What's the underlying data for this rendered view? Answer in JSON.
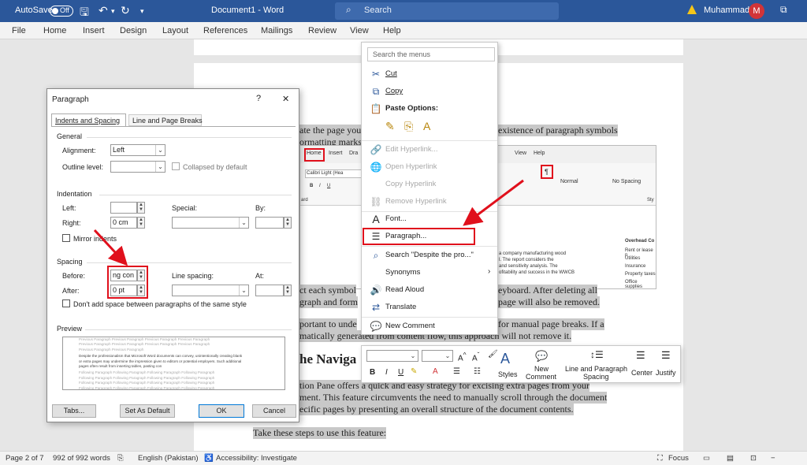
{
  "titlebar": {
    "autosave_label": "AutoSave",
    "autosave_state": "Off",
    "doc_title": "Document1 - Word",
    "search_placeholder": "Search",
    "user_name": "Muhammad",
    "user_initial": "M"
  },
  "menubar": {
    "items": [
      "File",
      "Home",
      "Insert",
      "Design",
      "Layout",
      "References",
      "Mailings",
      "Review",
      "View",
      "Help"
    ]
  },
  "document": {
    "line1a": "ate the page you",
    "line1b": "existence of paragraph symbols",
    "line2": "ormatting marks",
    "para2_line1a": "ct each symbol",
    "para2_line1b": "eyboard. After deleting all",
    "para2_line2a": "graph and form",
    "para2_line2b": "page will also be removed.",
    "para3_line1a": "portant to unde",
    "para3_line1b": "for manual page breaks. If a",
    "para3_line2a": "matically generated from content flow, this approach will not remove it.",
    "heading": "he Naviga",
    "body1": "tion Pane offers a quick and easy strategy for excising extra pages from your",
    "body2": "ment. This feature circumvents the need to manually scroll through the document",
    "body3": "ecific pages by presenting an overall structure of the document contents.",
    "steps": "Take these steps to use this feature:"
  },
  "embedded": {
    "tabs": [
      "Home",
      "Insert",
      "Dra",
      "View",
      "Help"
    ],
    "font": "Calibri Light (Hea",
    "bold": "B",
    "italic": "I",
    "underline": "U",
    "style1": "Normal",
    "style2": "No Spacing",
    "right_heading": "Overhead Co",
    "right_lines": [
      "Rent or lease p",
      "Utilities",
      "Insurance",
      "Property taxes",
      "Office supplies"
    ],
    "mid_lines": [
      "a company manufacturing wood",
      "l. The report considers the",
      "and sensitivity analysis. The",
      "ofitability and success in the WWCB"
    ],
    "pilcrow": "¶",
    "ard": "ard",
    "sty": "Sty"
  },
  "dialog": {
    "title": "Paragraph",
    "help": "?",
    "close": "✕",
    "tab1": "Indents and Spacing",
    "tab2": "Line and Page Breaks",
    "general": "General",
    "alignment_label": "Alignment:",
    "alignment_value": "Left",
    "outline_label": "Outline level:",
    "collapsed_label": "Collapsed by default",
    "indentation": "Indentation",
    "left_label": "Left:",
    "right_label": "Right:",
    "right_value": "0 cm",
    "special_label": "Special:",
    "by_label": "By:",
    "mirror_label": "Mirror indents",
    "spacing": "Spacing",
    "before_label": "Before:",
    "before_value": "ng con",
    "after_label": "After:",
    "after_value": "0 pt",
    "line_spacing_label": "Line spacing:",
    "at_label": "At:",
    "dont_add_label": "Don't add space between paragraphs of the same style",
    "preview": "Preview",
    "preview_text": [
      "Previous Paragraph Previous Paragraph Previous Paragraph Previous Paragraph",
      "Previous Paragraph Previous Paragraph Previous Paragraph Previous Paragraph",
      "Previous Paragraph Previous Paragraph",
      "Despite the professionalism that Microsoft Word documents can convey, unintentionally creating blank",
      "or extra pages may undermine the impression given to editors or potential employers. Such additional",
      "pages often result from inserting tables, pasting con",
      "Following Paragraph Following Paragraph Following Paragraph Following Paragraph",
      "Following Paragraph Following Paragraph Following Paragraph Following Paragraph",
      "Following Paragraph Following Paragraph Following Paragraph Following Paragraph",
      "Following Paragraph Following Paragraph Following Paragraph Following Paragraph"
    ],
    "tabs_button": "Tabs...",
    "default_button": "Set As Default",
    "ok_button": "OK",
    "cancel_button": "Cancel"
  },
  "context_menu": {
    "search_placeholder": "Search the menus",
    "cut": "Cut",
    "copy": "Copy",
    "paste_options": "Paste Options:",
    "edit_hyperlink": "Edit Hyperlink...",
    "open_hyperlink": "Open Hyperlink",
    "copy_hyperlink": "Copy Hyperlink",
    "remove_hyperlink": "Remove Hyperlink",
    "font": "Font...",
    "paragraph": "Paragraph...",
    "search": "Search \"Despite the pro...\"",
    "synonyms": "Synonyms",
    "read_aloud": "Read Aloud",
    "translate": "Translate",
    "new_comment": "New Comment"
  },
  "mini_toolbar": {
    "bold": "B",
    "italic": "I",
    "underline": "U",
    "styles": "Styles",
    "new_comment_1": "New",
    "new_comment_2": "Comment",
    "line_spacing_1": "Line and Paragraph",
    "line_spacing_2": "Spacing",
    "center": "Center",
    "justify": "Justify"
  },
  "status": {
    "page": "Page 2 of 7",
    "words": "992 of 992 words",
    "language": "English (Pakistan)",
    "accessibility": "Accessibility: Investigate",
    "focus": "Focus"
  },
  "colors": {
    "accent": "#2b579a",
    "highlight": "#e0101c"
  }
}
